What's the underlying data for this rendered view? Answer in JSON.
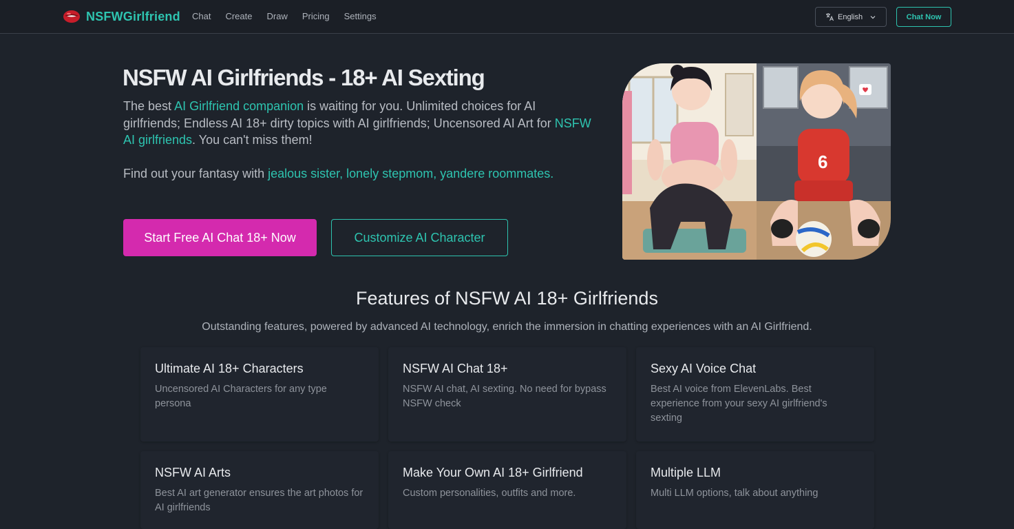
{
  "brand": {
    "name": "NSFWGirlfriend"
  },
  "nav": {
    "links": [
      "Chat",
      "Create",
      "Draw",
      "Pricing",
      "Settings"
    ],
    "language": "English",
    "cta": "Chat Now"
  },
  "hero": {
    "title": "NSFW AI Girlfriends - 18+ AI Sexting",
    "desc_1": "The best ",
    "desc_link_1": "AI Girlfriend companion",
    "desc_2": " is waiting for you. Unlimited choices for AI girlfriends; Endless AI 18+ dirty topics with AI girlfriends; Uncensored AI Art for ",
    "desc_link_2": "NSFW AI girlfriends",
    "desc_3": ". You can't miss them!",
    "fantasy_prefix": "Find out your fantasy with ",
    "fantasy_links": "jealous sister, lonely stepmom, yandere roommates.",
    "primary_button": "Start Free AI Chat 18+ Now",
    "secondary_button": "Customize AI Character"
  },
  "features": {
    "title": "Features of NSFW AI 18+ Girlfriends",
    "subtitle": "Outstanding features, powered by advanced AI technology, enrich the immersion in chatting experiences with an AI Girlfriend.",
    "cards": [
      {
        "title": "Ultimate AI 18+ Characters",
        "desc": "Uncensored AI Characters for any type persona"
      },
      {
        "title": "NSFW AI Chat 18+",
        "desc": "NSFW AI chat, AI sexting. No need for bypass NSFW check"
      },
      {
        "title": "Sexy AI Voice Chat",
        "desc": "Best AI voice from ElevenLabs. Best experience from your sexy AI girlfriend's sexting"
      },
      {
        "title": "NSFW AI Arts",
        "desc": "Best AI art generator ensures the art photos for AI girlfriends"
      },
      {
        "title": "Make Your Own AI 18+ Girlfriend",
        "desc": "Custom personalities, outfits and more."
      },
      {
        "title": "Multiple LLM",
        "desc": "Multi LLM options, talk about anything"
      }
    ]
  },
  "colors": {
    "accent": "#2ec4b0",
    "primary": "#d42aae",
    "background": "#1e232b"
  }
}
